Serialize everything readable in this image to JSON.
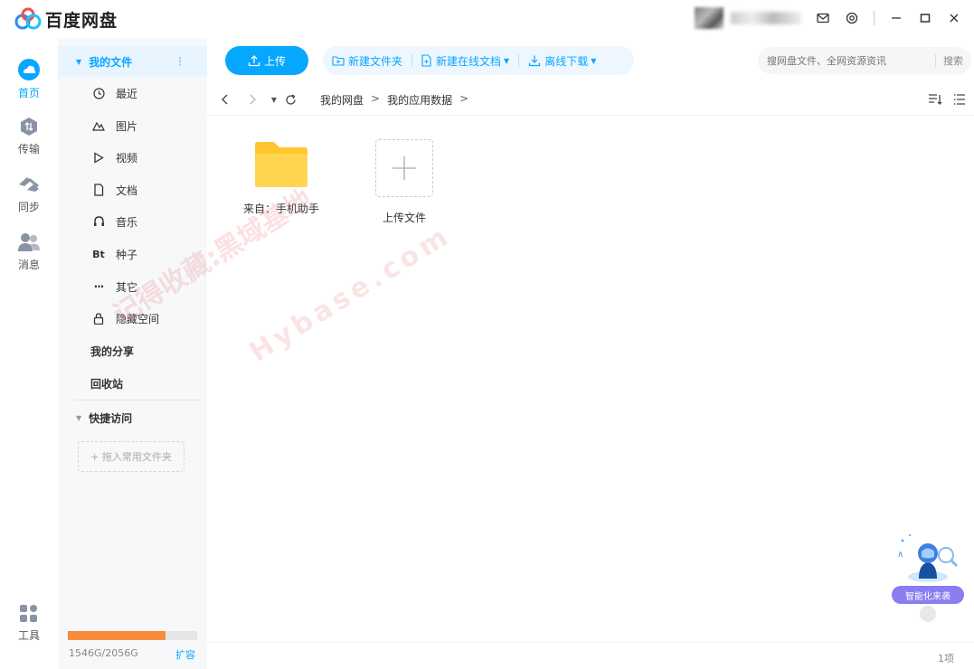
{
  "app": {
    "title": "百度网盘"
  },
  "window_controls": {
    "mail": "mail-icon",
    "settings": "settings-icon",
    "minimize": "minimize-icon",
    "maximize": "maximize-icon",
    "close": "close-icon"
  },
  "rail": [
    {
      "label": "首页",
      "icon": "cloud-icon",
      "active": true
    },
    {
      "label": "传输",
      "icon": "transfer-icon",
      "active": false
    },
    {
      "label": "同步",
      "icon": "sync-icon",
      "active": false
    },
    {
      "label": "消息",
      "icon": "message-icon",
      "active": false
    },
    {
      "label": "工具",
      "icon": "tools-icon",
      "active": false
    }
  ],
  "sidebar": {
    "my_files": "我的文件",
    "items": [
      {
        "label": "最近",
        "icon": "clock-icon"
      },
      {
        "label": "图片",
        "icon": "image-icon"
      },
      {
        "label": "视频",
        "icon": "video-icon"
      },
      {
        "label": "文档",
        "icon": "document-icon"
      },
      {
        "label": "音乐",
        "icon": "music-icon"
      },
      {
        "label": "种子",
        "icon": "torrent-icon",
        "glyph": "Bt"
      },
      {
        "label": "其它",
        "icon": "more-icon"
      },
      {
        "label": "隐藏空间",
        "icon": "lock-icon"
      }
    ],
    "my_share": "我的分享",
    "recycle": "回收站",
    "quick_access": "快捷访问",
    "drop_hint": "+ 拖入常用文件夹",
    "storage": {
      "used_fraction": 0.752,
      "text": "1546G/2056G",
      "expand": "扩容"
    }
  },
  "toolbar": {
    "upload": "上传",
    "new_folder": "新建文件夹",
    "new_online_doc": "新建在线文档",
    "offline_download": "离线下载",
    "search_placeholder": "搜网盘文件、全网资源资讯",
    "search_btn": "搜索"
  },
  "breadcrumb": [
    "我的网盘",
    "我的应用数据"
  ],
  "files": [
    {
      "label": "来自：手机助手",
      "icon": "folder-icon"
    },
    {
      "label": "上传文件",
      "icon": "plus-icon"
    }
  ],
  "watermark": {
    "line1": "记得收藏:黑域基地",
    "line2": "Hybase.com"
  },
  "assistant": {
    "label": "智能化来袭"
  },
  "status": {
    "count": "1项"
  },
  "colors": {
    "accent": "#06a7ff",
    "folder": "#ffd54f",
    "storage": "#fa8a3c",
    "assistant": "#8a7cf2"
  }
}
